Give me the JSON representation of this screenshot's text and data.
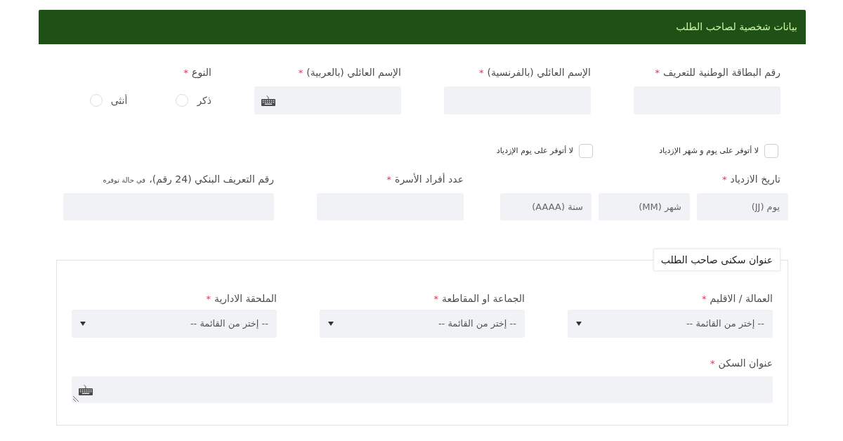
{
  "header": {
    "title": "بيانات شخصية لصاحب الطلب"
  },
  "personal_fields": [
    {
      "kind": "text",
      "label": "رقم البطاقة الوطنية للتعريف",
      "required_mark": "*"
    },
    {
      "kind": "text",
      "label": "الإسم العائلي (بالفرنسية)",
      "required_mark": "*"
    },
    {
      "kind": "text",
      "label": "الإسم العائلي (بالعربية)",
      "required_mark": "*",
      "keyboard": true
    },
    {
      "kind": "radio",
      "label": "النوع",
      "required_mark": "*",
      "options": [
        {
          "label": "ذكر",
          "selected": false
        },
        {
          "label": "أنثى",
          "selected": false
        }
      ]
    }
  ],
  "birth_checkboxes": [
    {
      "label": "لا أتوفر على يوم و شهر الإزدياد",
      "checked": false
    },
    {
      "label": "لا أتوفر على يوم الإزدياد",
      "checked": false
    }
  ],
  "details_fields": [
    {
      "kind": "date",
      "label": "تاريخ الازدياد",
      "required_mark": "*",
      "parts": [
        {
          "placeholder": "يوم (JJ)"
        },
        {
          "placeholder": "شهر (MM)"
        },
        {
          "placeholder": "سنة (AAAA)"
        }
      ]
    },
    {
      "kind": "text",
      "label": "عدد أفراد الأسرة",
      "required_mark": "*"
    },
    {
      "kind": "text",
      "label": "رقم التعريف البنكي (24 رقم)،",
      "note": "في حالة توفره"
    }
  ],
  "address_section": {
    "legend": "عنوان سكنى صاحب الطلب",
    "selects": [
      {
        "label": "العمالة / الاقليم",
        "required_mark": "*",
        "value": "-- إختر من القائمة --"
      },
      {
        "label": "الجماعة او المقاطعة",
        "required_mark": "*",
        "value": "-- إختر من القائمة --"
      },
      {
        "label": "الملحقة الادارية",
        "required_mark": "*",
        "value": "-- إختر من القائمة --"
      }
    ],
    "address": {
      "label": "عنوان السكن",
      "required_mark": "*",
      "keyboard": true
    }
  }
}
